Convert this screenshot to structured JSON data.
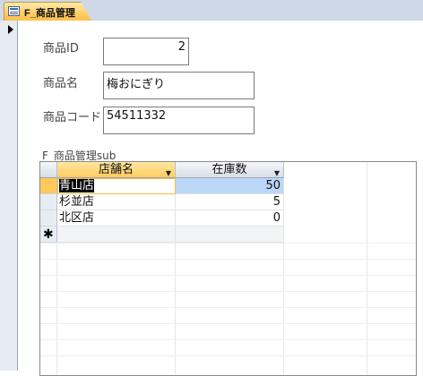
{
  "tab": {
    "title": "F_商品管理",
    "icon": "form-icon"
  },
  "fields": {
    "product_id": {
      "label": "商品ID",
      "value": "2"
    },
    "product_name": {
      "label": "商品名",
      "value": "梅おにぎり"
    },
    "product_code": {
      "label": "商品コード",
      "value": "54511332"
    }
  },
  "subform": {
    "label": "F_商品管理sub",
    "columns": [
      "店舗名",
      "在庫数"
    ],
    "rows": [
      {
        "store": "青山店",
        "stock": "50"
      },
      {
        "store": "杉並店",
        "stock": "5"
      },
      {
        "store": "北区店",
        "stock": "0"
      }
    ],
    "new_row_marker": "✱"
  }
}
